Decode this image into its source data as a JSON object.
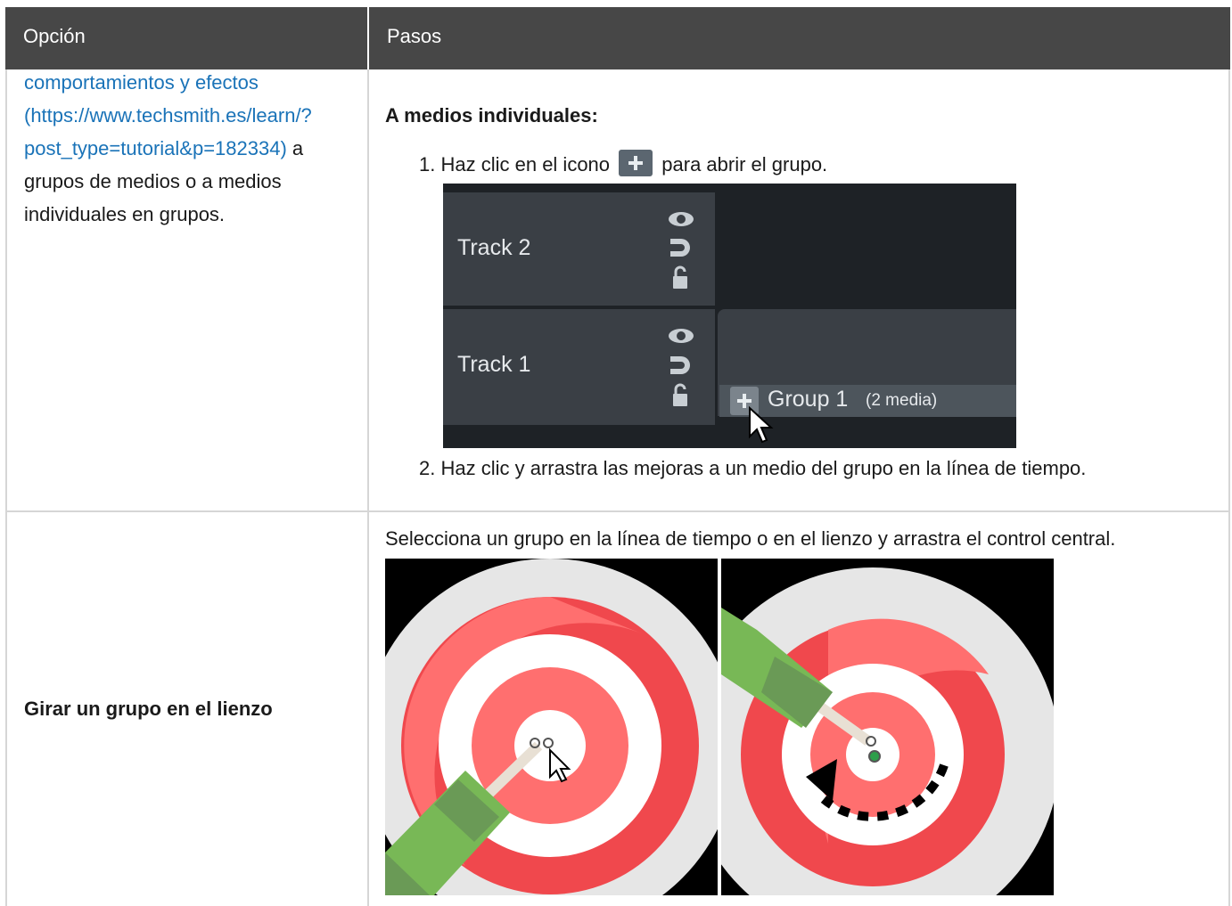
{
  "table": {
    "headers": {
      "option": "Opción",
      "steps": "Pasos"
    }
  },
  "row1": {
    "option_link_lines": [
      "comportamientos y efectos",
      "(https://www.techsmith.es/learn/?",
      "post_type=tutorial&p=182334)"
    ],
    "option_text_after_link": " a",
    "option_text_lines": [
      "grupos de medios o a medios",
      "individuales en grupos."
    ],
    "subheading": "A medios individuales:",
    "step1_num": "1.",
    "step1_before": "Haz clic en el icono",
    "step1_after": "para abrir el grupo.",
    "step2_num": "2.",
    "step2_text": "Haz clic y arrastra las mejoras a un medio del grupo en la línea de tiempo.",
    "timeline": {
      "track2": "Track 2",
      "track1": "Track 1",
      "group_title": "Group 1",
      "group_count": "(2 media)"
    }
  },
  "row2": {
    "option": "Girar un grupo en el lienzo",
    "instruction": "Selecciona un grupo en la línea de tiempo o en el lienzo y arrastra el control central."
  },
  "colors": {
    "header_bg": "#474747",
    "link": "#1a73b8",
    "target_red": "#f0484d",
    "target_salmon": "#ff6f6f",
    "dart_green": "#78b856"
  }
}
